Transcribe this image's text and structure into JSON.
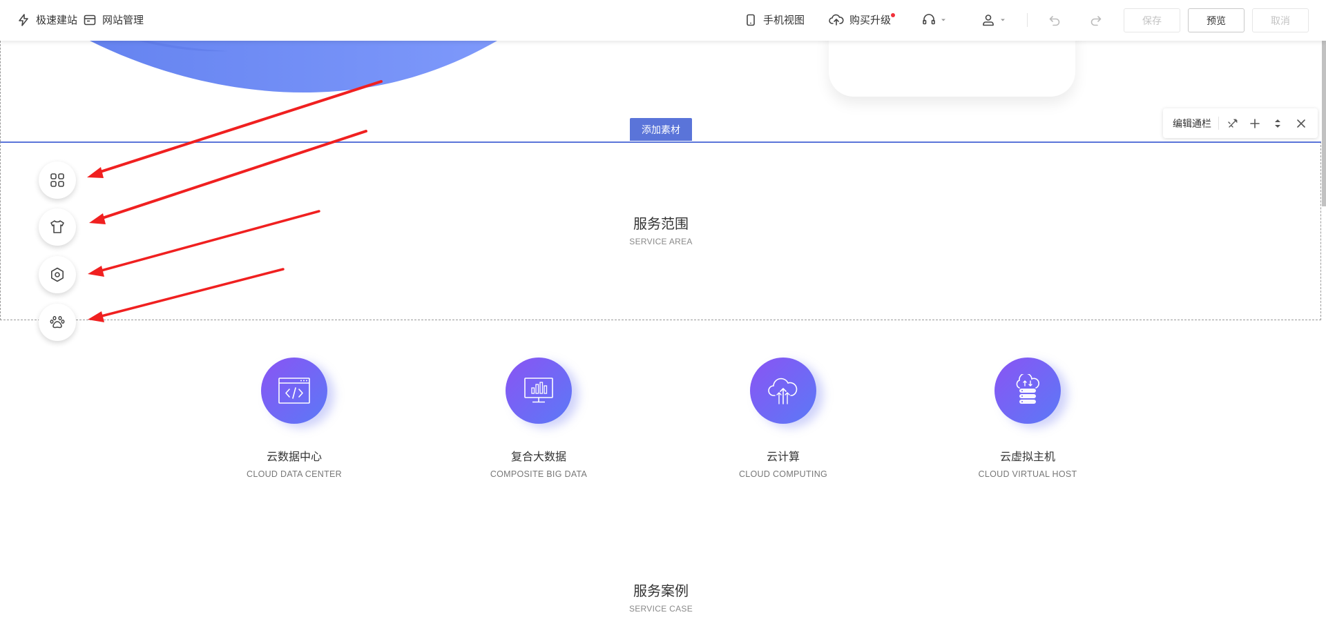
{
  "toolbar": {
    "quick_build": "极速建站",
    "site_manage": "网站管理",
    "mobile_view": "手机视图",
    "upgrade": "购买升级",
    "save": "保存",
    "preview": "预览",
    "cancel": "取消"
  },
  "editor": {
    "add_material": "添加素材",
    "edit_bar_label": "编辑通栏"
  },
  "sections": {
    "service_area": {
      "title": "服务范围",
      "subtitle": "SERVICE AREA"
    },
    "service_case": {
      "title": "服务案例",
      "subtitle": "SERVICE CASE"
    }
  },
  "services": [
    {
      "title": "云数据中心",
      "subtitle": "CLOUD DATA CENTER",
      "icon": "code-window-icon"
    },
    {
      "title": "复合大数据",
      "subtitle": "COMPOSITE BIG DATA",
      "icon": "monitor-chart-icon"
    },
    {
      "title": "云计算",
      "subtitle": "CLOUD COMPUTING",
      "icon": "cloud-upload-icon"
    },
    {
      "title": "云虚拟主机",
      "subtitle": "CLOUD VIRTUAL HOST",
      "icon": "cloud-server-icon"
    }
  ],
  "side_tools": [
    "apps-icon",
    "shirt-icon",
    "settings-icon",
    "paw-icon"
  ],
  "colors": {
    "accent": "#5a74d9",
    "gradient_start": "#8a54f4",
    "gradient_end": "#5b79f6",
    "annotation_arrow": "#f02020",
    "notification_dot": "#f0303a"
  }
}
